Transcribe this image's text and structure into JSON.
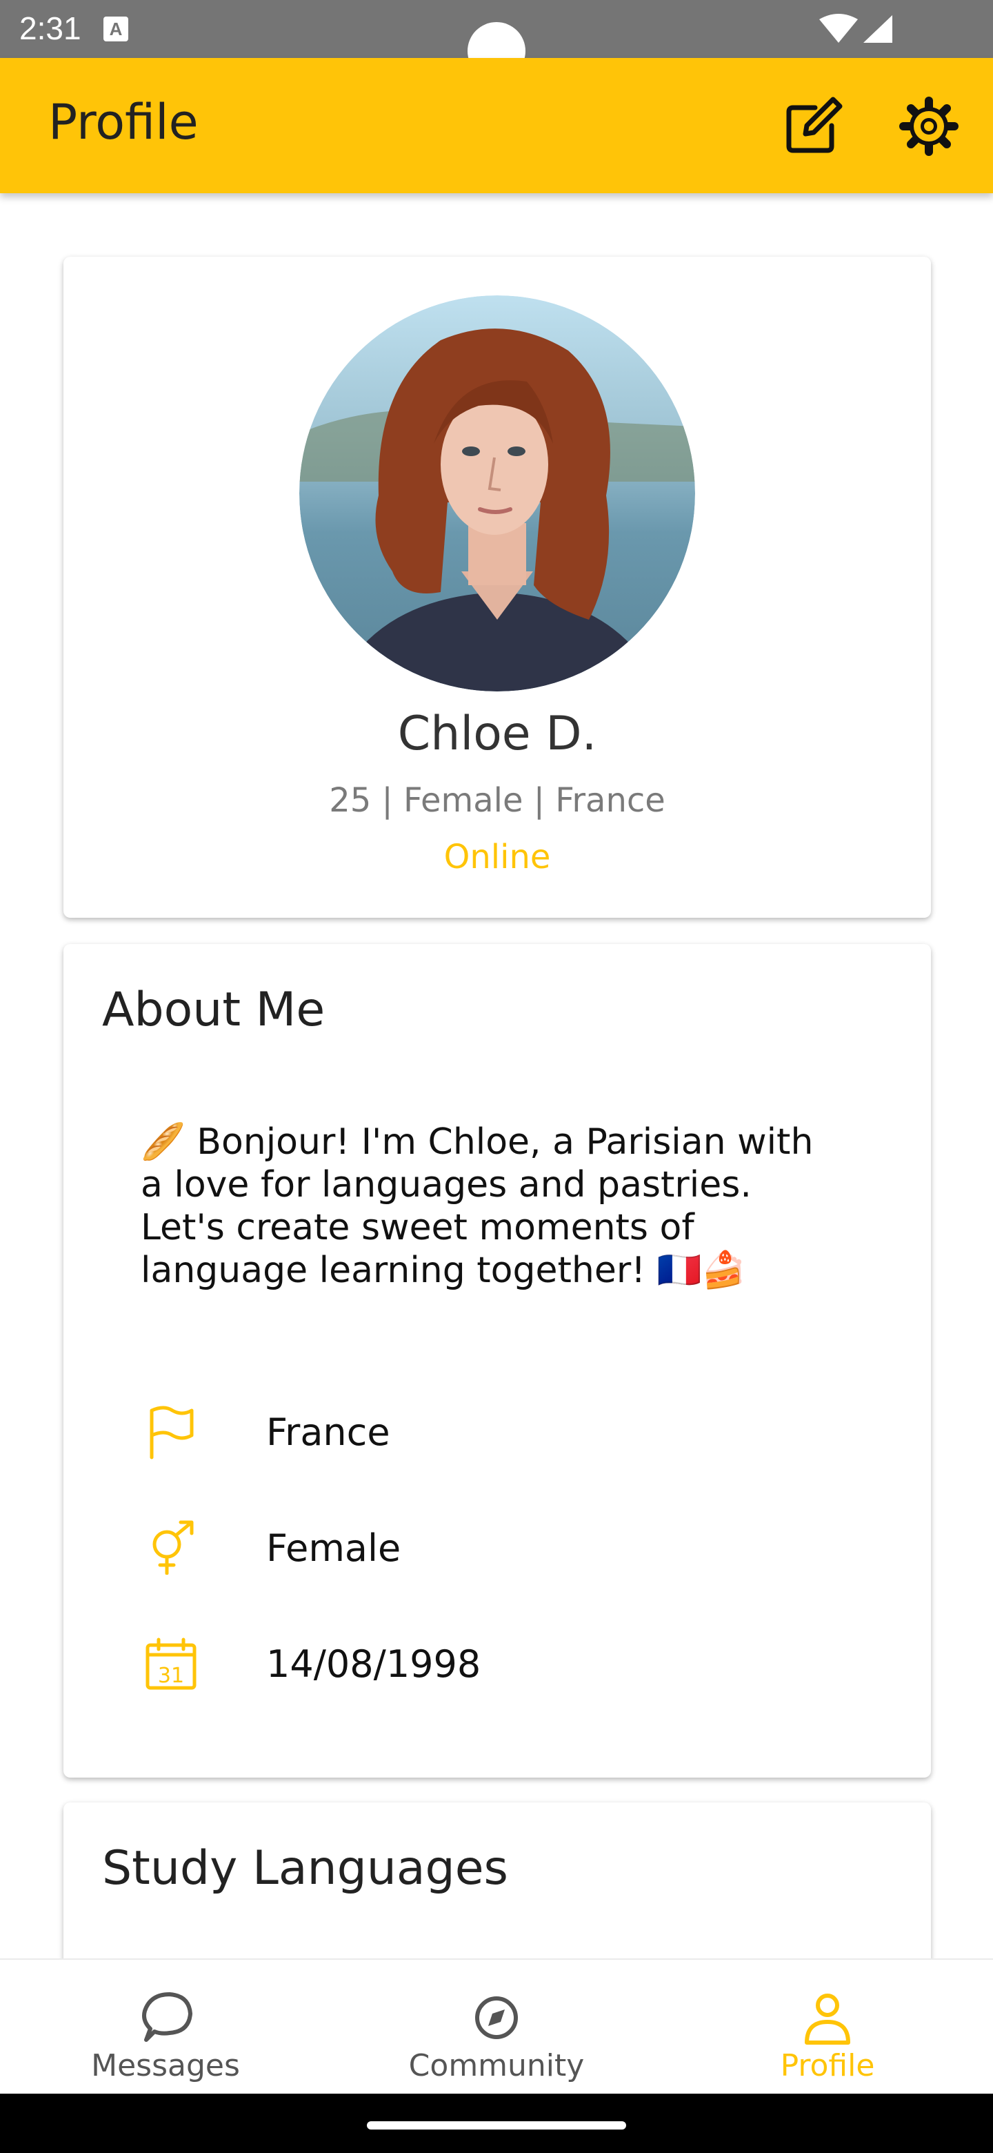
{
  "status_bar": {
    "time": "2:31",
    "notification_icon_letter": "A",
    "icons": [
      "wifi-icon",
      "signal-icon"
    ]
  },
  "app_bar": {
    "title": "Profile",
    "actions": [
      "edit-icon",
      "gear-icon"
    ],
    "background": "#ffc408"
  },
  "profile": {
    "name": "Chloe D.",
    "meta": "25 | Female | France",
    "status": "Online",
    "status_color": "#ffc408"
  },
  "about": {
    "title": "About Me",
    "bio": "🥖 Bonjour! I'm Chloe, a Parisian with a love for languages and pastries. Let's create sweet moments of language learning together! 🇫🇷🍰",
    "details": [
      {
        "icon": "flag-icon",
        "label": "France"
      },
      {
        "icon": "gender-icon",
        "label": "Female"
      },
      {
        "icon": "calendar-icon",
        "label": "14/08/1998",
        "calendar_day": "31"
      }
    ]
  },
  "study_languages": {
    "title": "Study Languages"
  },
  "bottom_nav": {
    "items": [
      {
        "label": "Messages",
        "icon": "messages-icon",
        "active": false
      },
      {
        "label": "Community",
        "icon": "compass-icon",
        "active": false
      },
      {
        "label": "Profile",
        "icon": "person-icon",
        "active": true
      }
    ],
    "active_color": "#ffc408",
    "inactive_color": "#555555"
  }
}
